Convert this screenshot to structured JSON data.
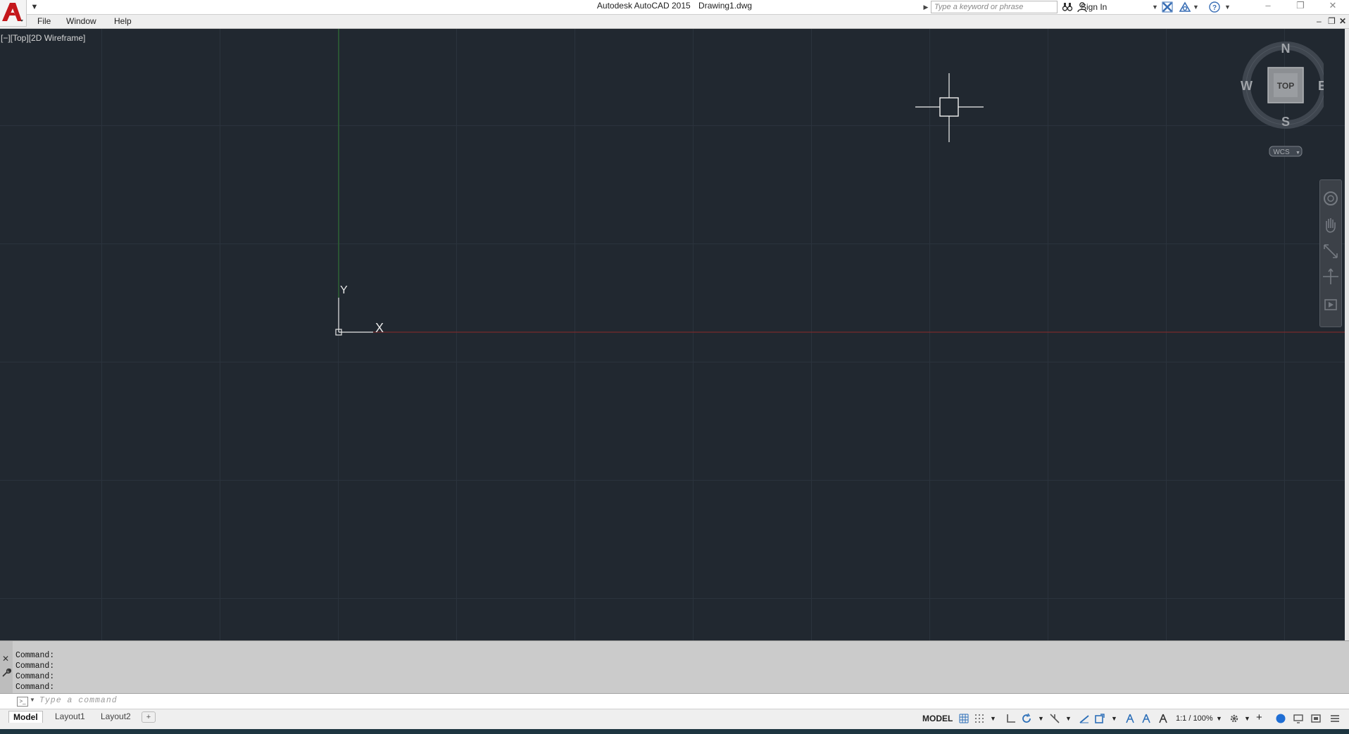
{
  "app": {
    "title_app": "Autodesk AutoCAD 2015",
    "title_doc": "Drawing1.dwg"
  },
  "search": {
    "placeholder": "Type a keyword or phrase"
  },
  "account": {
    "sign_in_label": "Sign In"
  },
  "menu": {
    "items": [
      "File",
      "Window",
      "Help"
    ]
  },
  "viewport": {
    "label": "[−][Top][2D Wireframe]",
    "ucs_x_label": "X",
    "ucs_y_label": "Y"
  },
  "viewcube": {
    "face_label": "TOP",
    "north": "N",
    "south": "S",
    "east": "E",
    "west": "W",
    "wcs_label": "WCS"
  },
  "command": {
    "history": [
      "Command:",
      "Command:",
      "Command:",
      "Command:"
    ],
    "placeholder": "Type a command"
  },
  "layout_tabs": [
    "Model",
    "Layout1",
    "Layout2"
  ],
  "status": {
    "space_label": "MODEL",
    "annotation_scale": "1:1 / 100%"
  },
  "colors": {
    "canvas_bg": "#212830",
    "grid_line": "#2b333d",
    "x_axis": "#8a2a2a",
    "y_axis": "#2f7a2f",
    "app_red": "#c4171b"
  },
  "icons": [
    "autocad-logo-icon",
    "binoculars-icon",
    "user-icon",
    "exchange-x-icon",
    "autodesk-360-icon",
    "help-icon",
    "minimize-icon",
    "restore-icon",
    "close-icon",
    "crosshair-cursor",
    "ucs-icon",
    "viewcube",
    "navigation-bar",
    "wrench-icon",
    "grid-icon",
    "snap-icon",
    "ortho-icon",
    "polar-icon",
    "osnap-icon",
    "gear-icon",
    "hamburger-menu-icon"
  ]
}
